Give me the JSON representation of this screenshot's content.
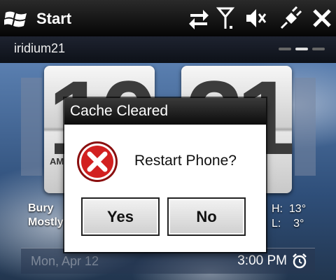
{
  "status_bar": {
    "start_label": "Start",
    "icons": [
      "data-sync-icon",
      "signal-icon",
      "volume-muted-icon",
      "power-plug-icon",
      "close-icon"
    ]
  },
  "sub_bar": {
    "device_name": "iridium21"
  },
  "home": {
    "clock": {
      "hour_digits": "10",
      "minute_digits": "21",
      "ampm": "AM"
    },
    "weather": {
      "city_line1": "Bury",
      "city_line2": "Mostly",
      "high": "H:  13°",
      "low": "L:    3°"
    },
    "date": "Mon, Apr 12",
    "time": "3:00 PM"
  },
  "dialog": {
    "title": "Cache Cleared",
    "message": "Restart Phone?",
    "icon": "error-icon",
    "yes_label": "Yes",
    "no_label": "No"
  },
  "colors": {
    "error_red": "#d22020",
    "status_bar_bg": "#111111",
    "dialog_title_bg": "#1a1a1a"
  }
}
